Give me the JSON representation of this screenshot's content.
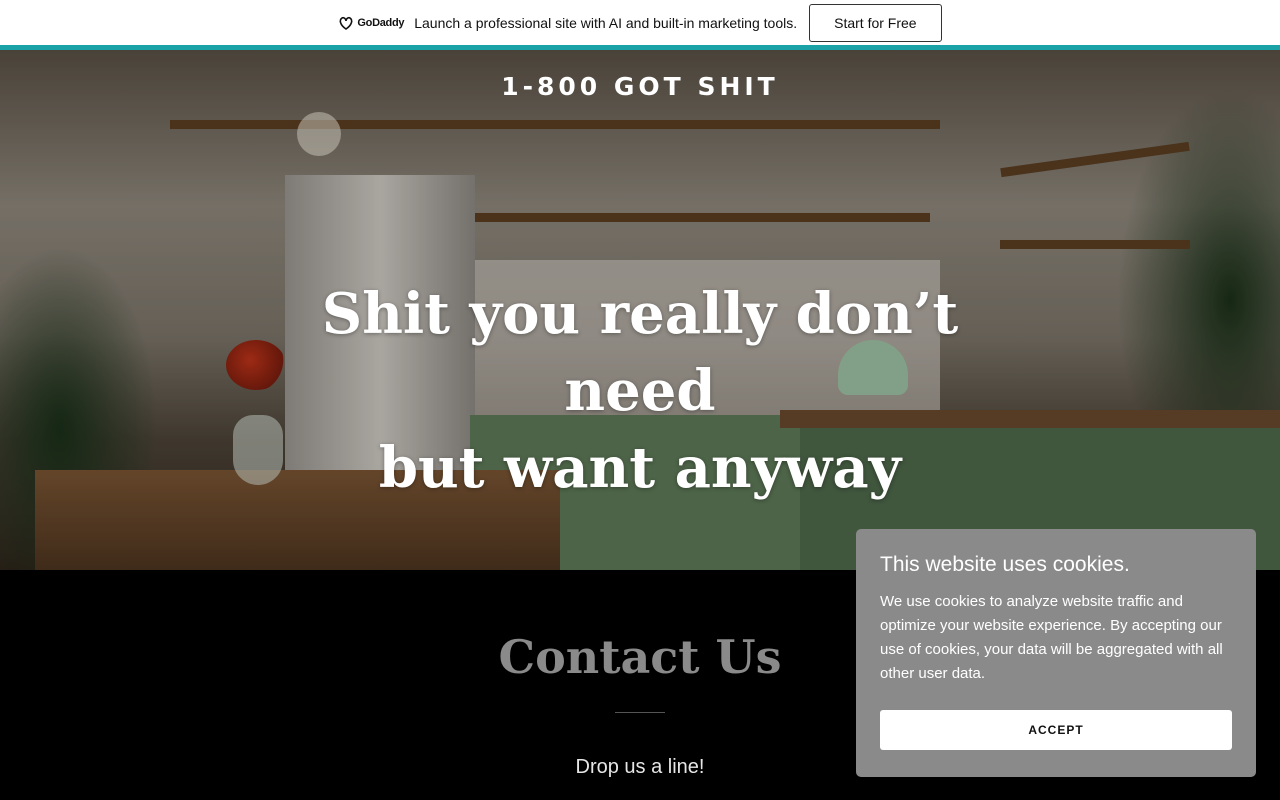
{
  "promo": {
    "logo_text": "GoDaddy",
    "message": "Launch a professional site with AI and built-in marketing tools.",
    "cta_label": "Start for Free"
  },
  "hero": {
    "brand": "1-800 GOT SHIT",
    "headline_line1": "Shit you really don’t need",
    "headline_line2": "but want anyway"
  },
  "contact": {
    "title": "Contact Us",
    "subtitle": "Drop us a line!"
  },
  "cookie_banner": {
    "title": "This website uses cookies.",
    "body": "We use cookies to analyze website traffic and optimize your website experience. By accepting our use of cookies, your data will be aggregated with all other user data.",
    "accept_label": "ACCEPT"
  },
  "colors": {
    "promo_accent": "#1BA2A6",
    "cookie_bg": "#8A8A8A",
    "contact_bg": "#000000"
  }
}
